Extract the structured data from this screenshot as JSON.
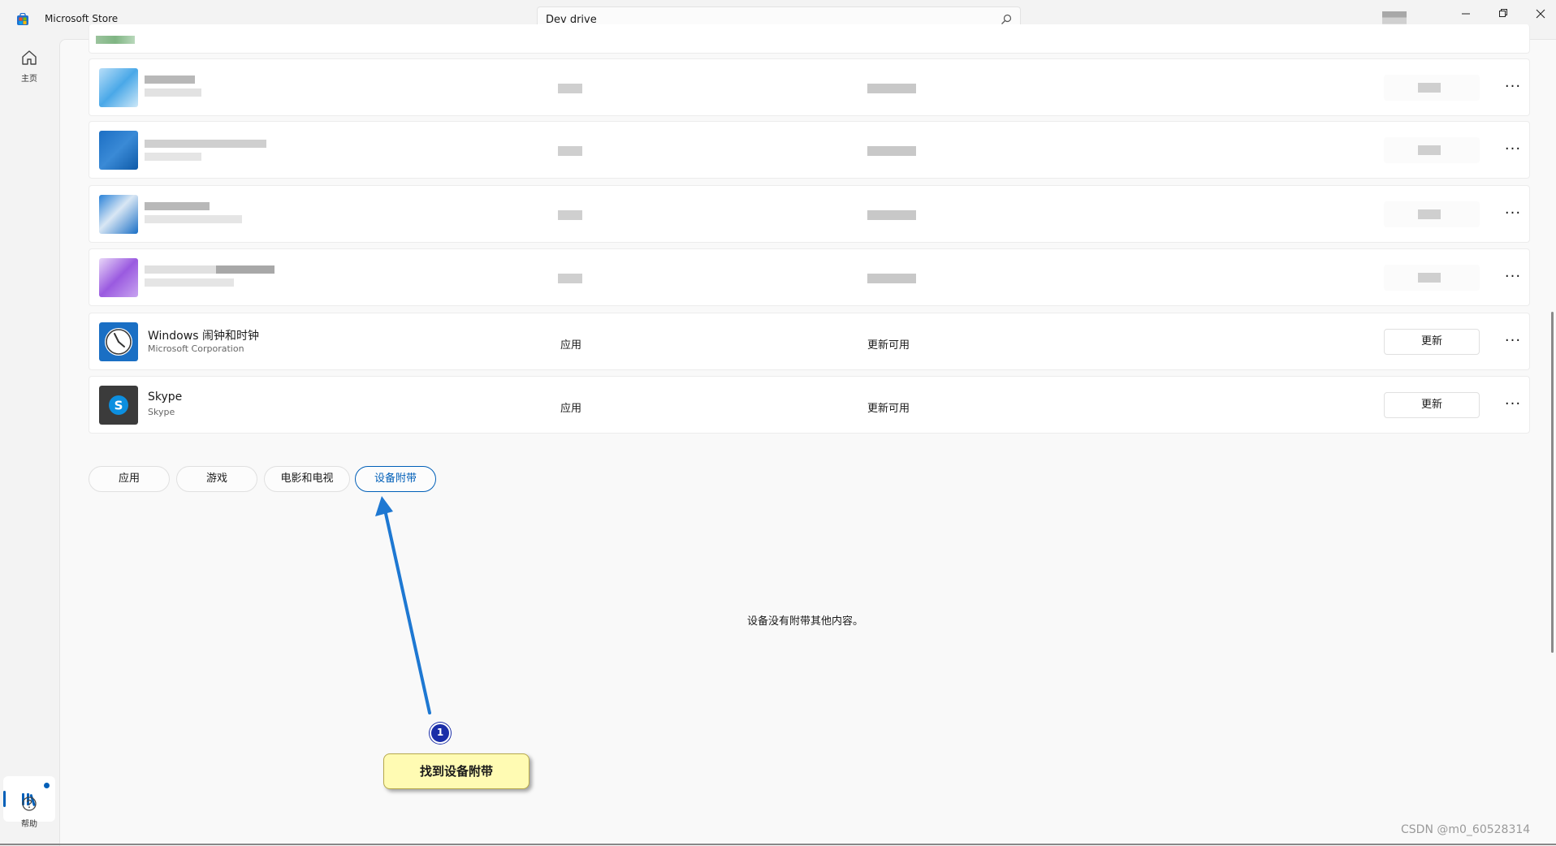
{
  "app": {
    "title": "Microsoft Store"
  },
  "search": {
    "value": "Dev drive"
  },
  "sidebar": {
    "home_label": "主页",
    "help_label": "帮助"
  },
  "apps": [
    {
      "name": "Windows 闹钟和时钟",
      "publisher": "Microsoft Corporation",
      "type": "应用",
      "status": "更新可用",
      "action": "更新"
    },
    {
      "name": "Skype",
      "publisher": "Skype",
      "type": "应用",
      "status": "更新可用",
      "action": "更新"
    }
  ],
  "filter_tabs": [
    {
      "label": "应用"
    },
    {
      "label": "游戏"
    },
    {
      "label": "电影和电视"
    },
    {
      "label": "设备附带",
      "active": true
    }
  ],
  "empty_message": "设备没有附带其他内容。",
  "annotation": {
    "step_number": "1",
    "callout_text": "找到设备附带",
    "arrow_color": "#1e78d2"
  },
  "watermark": "CSDN @m0_60528314",
  "colors": {
    "accent": "#005fb8"
  }
}
